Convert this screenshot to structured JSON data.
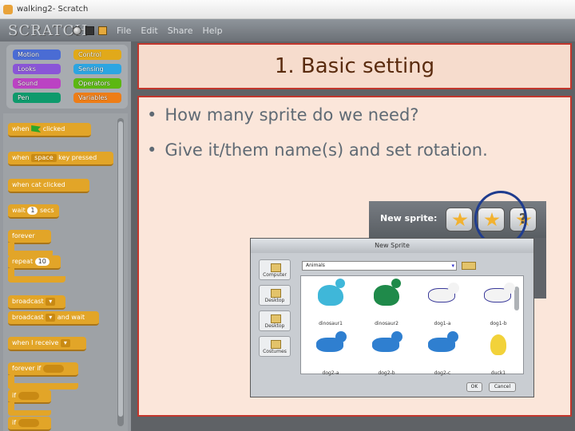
{
  "window": {
    "title": "walking2- Scratch"
  },
  "menubar": {
    "logo": "SCRATCH",
    "menus": [
      "File",
      "Edit",
      "Share",
      "Help"
    ]
  },
  "categories": [
    "Motion",
    "Control",
    "Looks",
    "Sensing",
    "Sound",
    "Operators",
    "Pen",
    "Variables"
  ],
  "category_colors": {
    "Motion": "#4a6cd4",
    "Control": "#e1a91a",
    "Looks": "#8a55d7",
    "Sensing": "#2ca5e2",
    "Sound": "#bb42c3",
    "Operators": "#5cb712",
    "Pen": "#0e9a6c",
    "Variables": "#ee7d16"
  },
  "blocks": {
    "when_flag_pre": "when",
    "when_flag_post": "clicked",
    "when_key_pre": "when",
    "when_key_key": "space",
    "when_key_post": "key pressed",
    "when_cat": "when cat clicked",
    "wait_pre": "wait",
    "wait_val": "1",
    "wait_post": "secs",
    "forever": "forever",
    "repeat": "repeat",
    "repeat_val": "10",
    "broadcast": "broadcast",
    "broadcast_wait": "broadcast",
    "broadcast_wait_post": "and wait",
    "when_receive": "when I receive",
    "forever_if": "forever if",
    "if1": "if",
    "if2": "if"
  },
  "slide": {
    "title": "1. Basic setting",
    "bullets": [
      "How many sprite do we need?",
      "Give it/them name(s) and set rotation."
    ]
  },
  "new_sprite": {
    "label": "New sprite:",
    "buttons": [
      "paint-new-sprite",
      "choose-sprite-from-file",
      "get-surprise-sprite"
    ]
  },
  "dialog": {
    "title": "New Sprite",
    "folder": "Animals",
    "locations": [
      "Computer",
      "Desktop",
      "Costumes"
    ],
    "location_partial": "Desktop",
    "sprites": [
      {
        "name": "dinosaur1",
        "color": "#3fb7d9",
        "kind": "dino"
      },
      {
        "name": "dinosaur2",
        "color": "#1f8a4a",
        "kind": "dino"
      },
      {
        "name": "dog1-a",
        "color": "#f3f3f3",
        "kind": "dog"
      },
      {
        "name": "dog1-b",
        "color": "#f3f3f3",
        "kind": "dog"
      },
      {
        "name": "dog2-a",
        "color": "#2f7fd0",
        "kind": "dog"
      },
      {
        "name": "dog2-b",
        "color": "#2f7fd0",
        "kind": "dog"
      },
      {
        "name": "dog2-c",
        "color": "#2f7fd0",
        "kind": "dog"
      },
      {
        "name": "duck1",
        "color": "#f2d23a",
        "kind": "duck"
      }
    ],
    "ok": "OK",
    "cancel": "Cancel"
  }
}
